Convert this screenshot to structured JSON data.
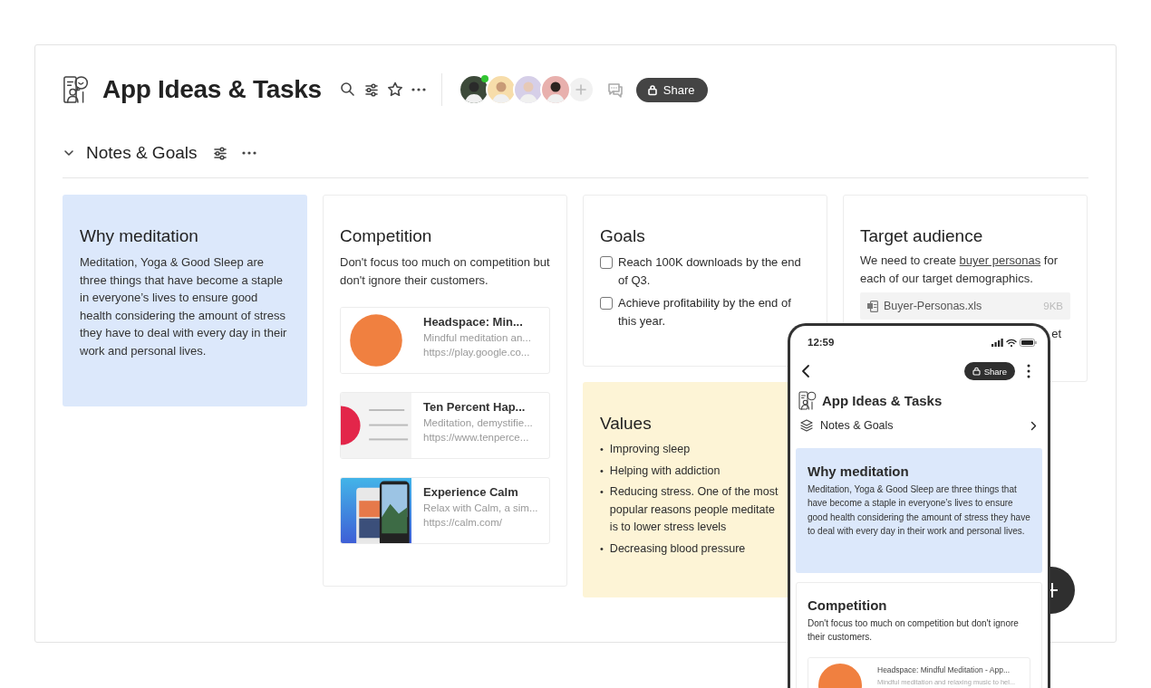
{
  "header": {
    "title": "App Ideas & Tasks",
    "share_label": "Share",
    "avatars": [
      {
        "online": true
      },
      {
        "online": false
      },
      {
        "online": false
      },
      {
        "online": false
      }
    ]
  },
  "section": {
    "title": "Notes & Goals",
    "expanded": true
  },
  "columns": [
    [
      {
        "kind": "note",
        "color": "#dce8fb",
        "title": "Why meditation",
        "body": "Meditation, Yoga & Good Sleep are three things that have become a staple in everyone’s lives to ensure good health considering the amount of stress they have to deal with every day in their work and personal lives."
      }
    ],
    [
      {
        "kind": "links",
        "color": "#ffffff",
        "title": "Competition",
        "body": "Don't focus too much on competition but don't ignore their customers.",
        "links": [
          {
            "title": "Headspace: Min...",
            "description": "Mindful meditation an...",
            "url": "https://play.google.co..."
          },
          {
            "title": "Ten Percent Hap...",
            "description": "Meditation, demystifie...",
            "url": "https://www.tenperce..."
          },
          {
            "title": "Experience Calm",
            "description": "Relax with Calm, a sim...",
            "url": "https://calm.com/"
          }
        ]
      }
    ],
    [
      {
        "kind": "checklist",
        "color": "#ffffff",
        "title": "Goals",
        "items": [
          {
            "text": "Reach 100K downloads by the end of Q3.",
            "checked": false
          },
          {
            "text": "Achieve profitability by the end of this year.",
            "checked": false
          }
        ]
      },
      {
        "kind": "bullets",
        "color": "#fdf4d6",
        "title": "Values",
        "marker": "•",
        "items": [
          "Improving sleep",
          "Helping with addiction",
          "Reducing stress. One of the most popular reasons people meditate is to lower stress levels",
          "Decreasing blood pressure"
        ]
      }
    ],
    [
      {
        "kind": "file_note",
        "color": "#ffffff",
        "title": "Target audience",
        "text_before": "We need to create",
        "link": "buyer personas",
        "text_after": "for each of our target demographics.",
        "file": {
          "name": "Buyer-Personas.xls",
          "size": "9KB"
        },
        "fragment": "et"
      }
    ]
  ],
  "phone": {
    "time": "12:59",
    "share_label": "Share",
    "title": "App Ideas & Tasks",
    "section": "Notes & Goals",
    "cards": [
      {
        "color": "#dce8fb",
        "title": "Why meditation",
        "body": "Meditation, Yoga & Good Sleep are three things that have become a staple in everyone’s lives to ensure good health considering the amount of stress they have to deal with every day in their work and personal lives."
      },
      {
        "color": "#ffffff",
        "title": "Competition",
        "body": "Don't focus too much on competition but don't ignore their customers.",
        "link": {
          "title": "Headspace: Mindful Meditation - App...",
          "description": "Mindful meditation and relaxing music to hel..."
        }
      }
    ]
  }
}
